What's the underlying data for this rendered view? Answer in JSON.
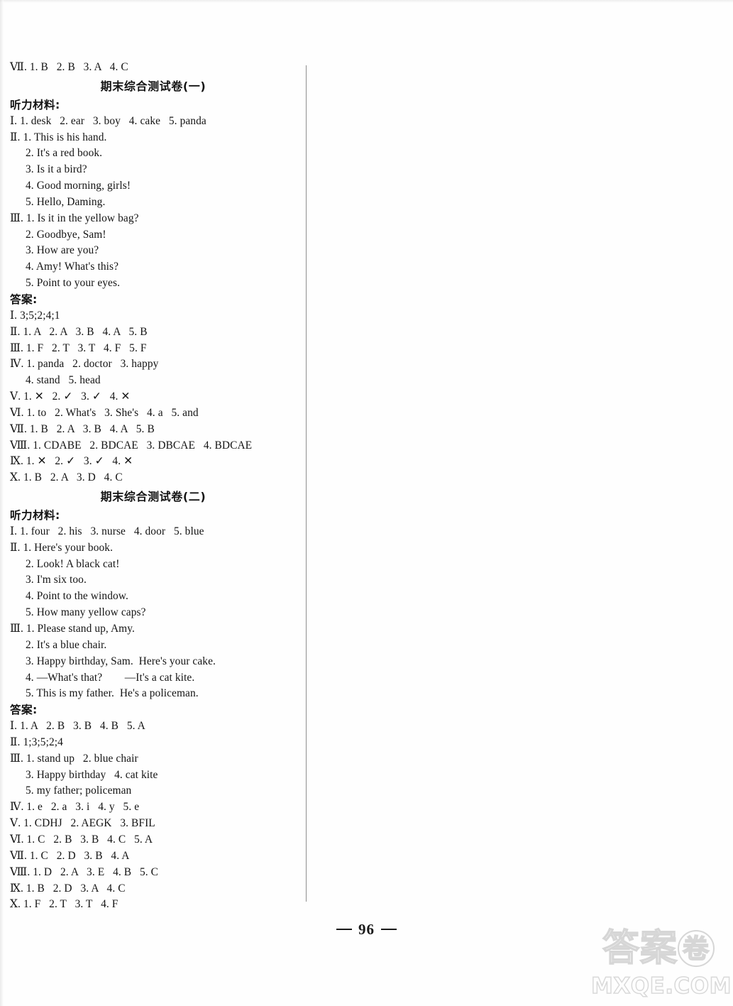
{
  "page": {
    "page_number_label": "96",
    "footer_dash": "—"
  },
  "watermark": {
    "cn_part1": "答案",
    "cn_circled": "卷",
    "domain": "MXQE.COM"
  },
  "content": {
    "lines": [
      {
        "id": "l01",
        "style": "plain",
        "text": "Ⅶ. 1. B   2. B   3. A   4. C"
      },
      {
        "id": "l02",
        "style": "title",
        "text": "期末综合测试卷(一)"
      },
      {
        "id": "l03",
        "style": "cn-head",
        "text": "听力材料:"
      },
      {
        "id": "l04",
        "style": "plain",
        "text": "Ⅰ. 1. desk   2. ear   3. boy   4. cake   5. panda"
      },
      {
        "id": "l05",
        "style": "plain",
        "text": "Ⅱ. 1. This is his hand."
      },
      {
        "id": "l06",
        "style": "indent",
        "text": "2. It's a red book."
      },
      {
        "id": "l07",
        "style": "indent",
        "text": "3. Is it a bird?"
      },
      {
        "id": "l08",
        "style": "indent",
        "text": "4. Good morning, girls!"
      },
      {
        "id": "l09",
        "style": "indent",
        "text": "5. Hello, Daming."
      },
      {
        "id": "l10",
        "style": "plain",
        "text": "Ⅲ. 1. Is it in the yellow bag?"
      },
      {
        "id": "l11",
        "style": "indent",
        "text": "2. Goodbye, Sam!"
      },
      {
        "id": "l12",
        "style": "indent",
        "text": "3. How are you?"
      },
      {
        "id": "l13",
        "style": "indent",
        "text": "4. Amy! What's this?"
      },
      {
        "id": "l14",
        "style": "indent",
        "text": "5. Point to your eyes."
      },
      {
        "id": "l15",
        "style": "cn-head",
        "text": "答案:"
      },
      {
        "id": "l16",
        "style": "plain",
        "text": "Ⅰ. 3;5;2;4;1"
      },
      {
        "id": "l17",
        "style": "plain",
        "text": "Ⅱ. 1. A   2. A   3. B   4. A   5. B"
      },
      {
        "id": "l18",
        "style": "plain",
        "text": "Ⅲ. 1. F   2. T   3. T   4. F   5. F"
      },
      {
        "id": "l19",
        "style": "plain",
        "text": "Ⅳ. 1. panda   2. doctor   3. happy"
      },
      {
        "id": "l20",
        "style": "indent",
        "text": "4. stand   5. head"
      },
      {
        "id": "l21",
        "style": "plain",
        "text": "Ⅴ. 1. ✕   2. ✓   3. ✓   4. ✕"
      },
      {
        "id": "l22",
        "style": "plain",
        "text": "Ⅵ. 1. to   2. What's   3. She's   4. a   5. and"
      },
      {
        "id": "l23",
        "style": "plain",
        "text": "Ⅶ. 1. B   2. A   3. B   4. A   5. B"
      },
      {
        "id": "l24",
        "style": "plain",
        "text": "Ⅷ. 1. CDABE   2. BDCAE   3. DBCAE   4. BDCAE"
      },
      {
        "id": "l25",
        "style": "plain",
        "text": "Ⅸ. 1. ✕   2. ✓   3. ✓   4. ✕"
      },
      {
        "id": "l26",
        "style": "plain",
        "text": "Ⅹ. 1. B   2. A   3. D   4. C"
      },
      {
        "id": "l27",
        "style": "title",
        "text": "期末综合测试卷(二)"
      },
      {
        "id": "l28",
        "style": "cn-head",
        "text": "听力材料:"
      },
      {
        "id": "l29",
        "style": "plain",
        "text": "Ⅰ. 1. four   2. his   3. nurse   4. door   5. blue"
      },
      {
        "id": "l30",
        "style": "plain",
        "text": "Ⅱ. 1. Here's your book."
      },
      {
        "id": "l31",
        "style": "indent",
        "text": "2. Look! A black cat!"
      },
      {
        "id": "l32",
        "style": "indent",
        "text": "3. I'm six too."
      },
      {
        "id": "l33",
        "style": "indent",
        "text": "4. Point to the window."
      },
      {
        "id": "l34",
        "style": "indent",
        "text": "5. How many yellow caps?"
      },
      {
        "id": "l35",
        "style": "plain",
        "text": "Ⅲ. 1. Please stand up, Amy."
      },
      {
        "id": "l36",
        "style": "indent",
        "text": "2. It's a blue chair."
      },
      {
        "id": "l37",
        "style": "indent",
        "text": "3. Happy birthday, Sam.  Here's your cake."
      },
      {
        "id": "l38",
        "style": "indent",
        "text": "4. —What's that?        —It's a cat kite."
      },
      {
        "id": "l39",
        "style": "indent",
        "text": "5. This is my father.  He's a policeman."
      },
      {
        "id": "l40",
        "style": "cn-head",
        "text": "答案:"
      },
      {
        "id": "l41",
        "style": "plain",
        "text": "Ⅰ. 1. A   2. B   3. B   4. B   5. A"
      },
      {
        "id": "l42",
        "style": "plain",
        "text": "Ⅱ. 1;3;5;2;4"
      },
      {
        "id": "l43",
        "style": "plain",
        "text": "Ⅲ. 1. stand up   2. blue chair"
      },
      {
        "id": "l44",
        "style": "indent",
        "text": "3. Happy birthday   4. cat kite"
      },
      {
        "id": "l45",
        "style": "indent",
        "text": "5. my father; policeman"
      },
      {
        "id": "l46",
        "style": "plain",
        "text": "Ⅳ. 1. e   2. a   3. i   4. y   5. e"
      },
      {
        "id": "l47",
        "style": "plain",
        "text": "Ⅴ. 1. CDHJ   2. AEGK   3. BFIL"
      },
      {
        "id": "l48",
        "style": "plain",
        "text": "Ⅵ. 1. C   2. B   3. B   4. C   5. A"
      },
      {
        "id": "l49",
        "style": "plain",
        "text": "Ⅶ. 1. C   2. D   3. B   4. A"
      },
      {
        "id": "l50",
        "style": "plain",
        "text": "Ⅷ. 1. D   2. A   3. E   4. B   5. C"
      },
      {
        "id": "l51",
        "style": "plain",
        "text": "Ⅸ. 1. B   2. D   3. A   4. C"
      },
      {
        "id": "l52",
        "style": "plain",
        "text": "Ⅹ. 1. F   2. T   3. T   4. F"
      }
    ]
  }
}
